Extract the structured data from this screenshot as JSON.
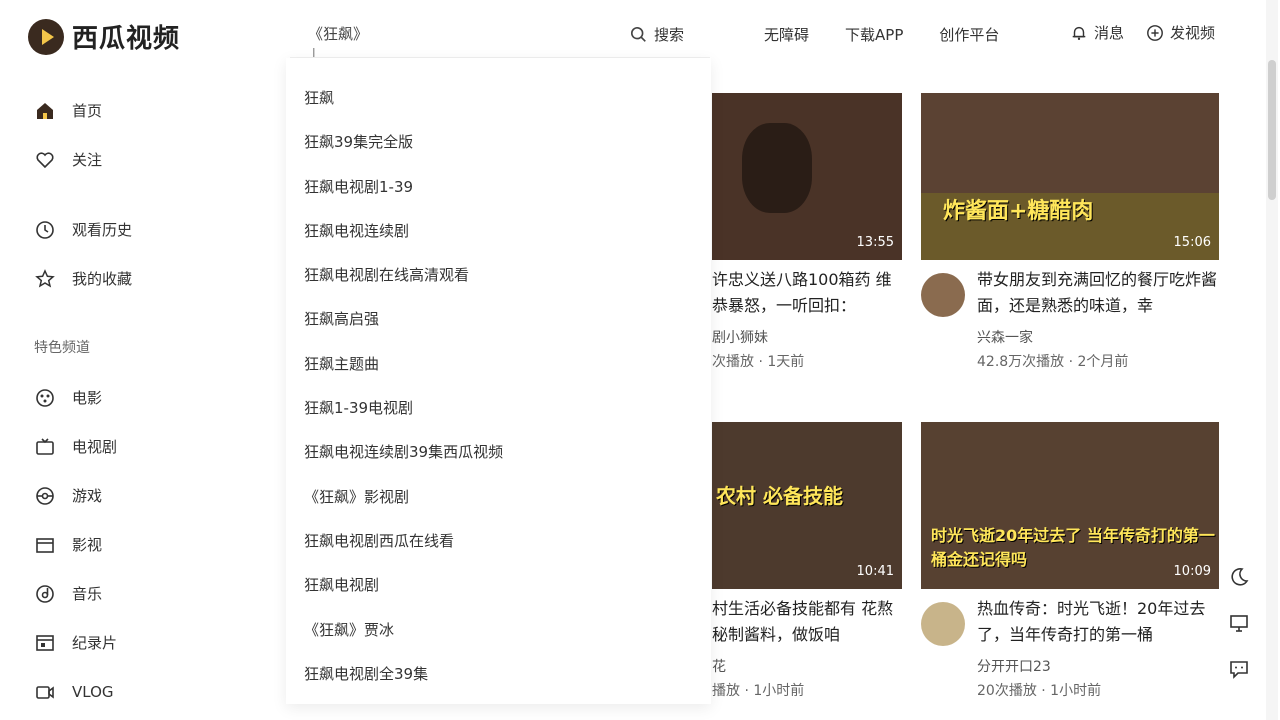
{
  "logo": {
    "text": "西瓜视频"
  },
  "search": {
    "value": "《狂飙》",
    "button_label": "搜索"
  },
  "top_nav": [
    "无障碍",
    "下载APP",
    "创作平台"
  ],
  "top_actions": {
    "messages": "消息",
    "upload": "发视频"
  },
  "sidebar": {
    "items_top": [
      {
        "label": "首页",
        "icon": "home-icon"
      },
      {
        "label": "关注",
        "icon": "heart-icon"
      }
    ],
    "items_mid": [
      {
        "label": "观看历史",
        "icon": "clock-icon"
      },
      {
        "label": "我的收藏",
        "icon": "star-icon"
      }
    ],
    "section_title": "特色频道",
    "channels": [
      {
        "label": "电影",
        "icon": "film-reel-icon"
      },
      {
        "label": "电视剧",
        "icon": "tv-icon"
      },
      {
        "label": "游戏",
        "icon": "gamepad-icon"
      },
      {
        "label": "影视",
        "icon": "clapper-icon"
      },
      {
        "label": "音乐",
        "icon": "music-disc-icon"
      },
      {
        "label": "纪录片",
        "icon": "documentary-icon"
      },
      {
        "label": "VLOG",
        "icon": "camera-icon"
      }
    ]
  },
  "suggestions": [
    "狂飙",
    "狂飙39集完全版",
    "狂飙电视剧1-39",
    "狂飙电视连续剧",
    "狂飙电视剧在线高清观看",
    "狂飙高启强",
    "狂飙主题曲",
    "狂飙1-39电视剧",
    "狂飙电视连续剧39集西瓜视频",
    "《狂飙》影视剧",
    "狂飙电视剧西瓜在线看",
    "狂飙电视剧",
    "《狂飙》贾冰",
    "狂飙电视剧全39集"
  ],
  "videos": [
    {
      "duration": "13:55",
      "title": "许忠义送八路100箱药 维恭暴怒，一听回扣：",
      "author": "剧小狮妹",
      "meta": "次播放 · 1天前",
      "caption": ""
    },
    {
      "duration": "15:06",
      "title": "带女朋友到充满回忆的餐厅吃炸酱面，还是熟悉的味道，幸",
      "author": "兴森一家",
      "meta": "42.8万次播放 · 2个月前",
      "caption": "炸酱面+糖醋肉"
    },
    {
      "duration": "10:41",
      "title": "村生活必备技能都有 花熬秘制酱料，做饭咱",
      "author": "花",
      "meta": "播放 · 1小时前",
      "caption": "农村 必备技能"
    },
    {
      "duration": "10:09",
      "title": "热血传奇：时光飞逝！20年过去了，当年传奇打的第一桶",
      "author": "分开开口23",
      "meta": "20次播放 · 1小时前",
      "caption": "时光飞逝20年过去了 当年传奇打的第一桶金还记得吗"
    }
  ]
}
